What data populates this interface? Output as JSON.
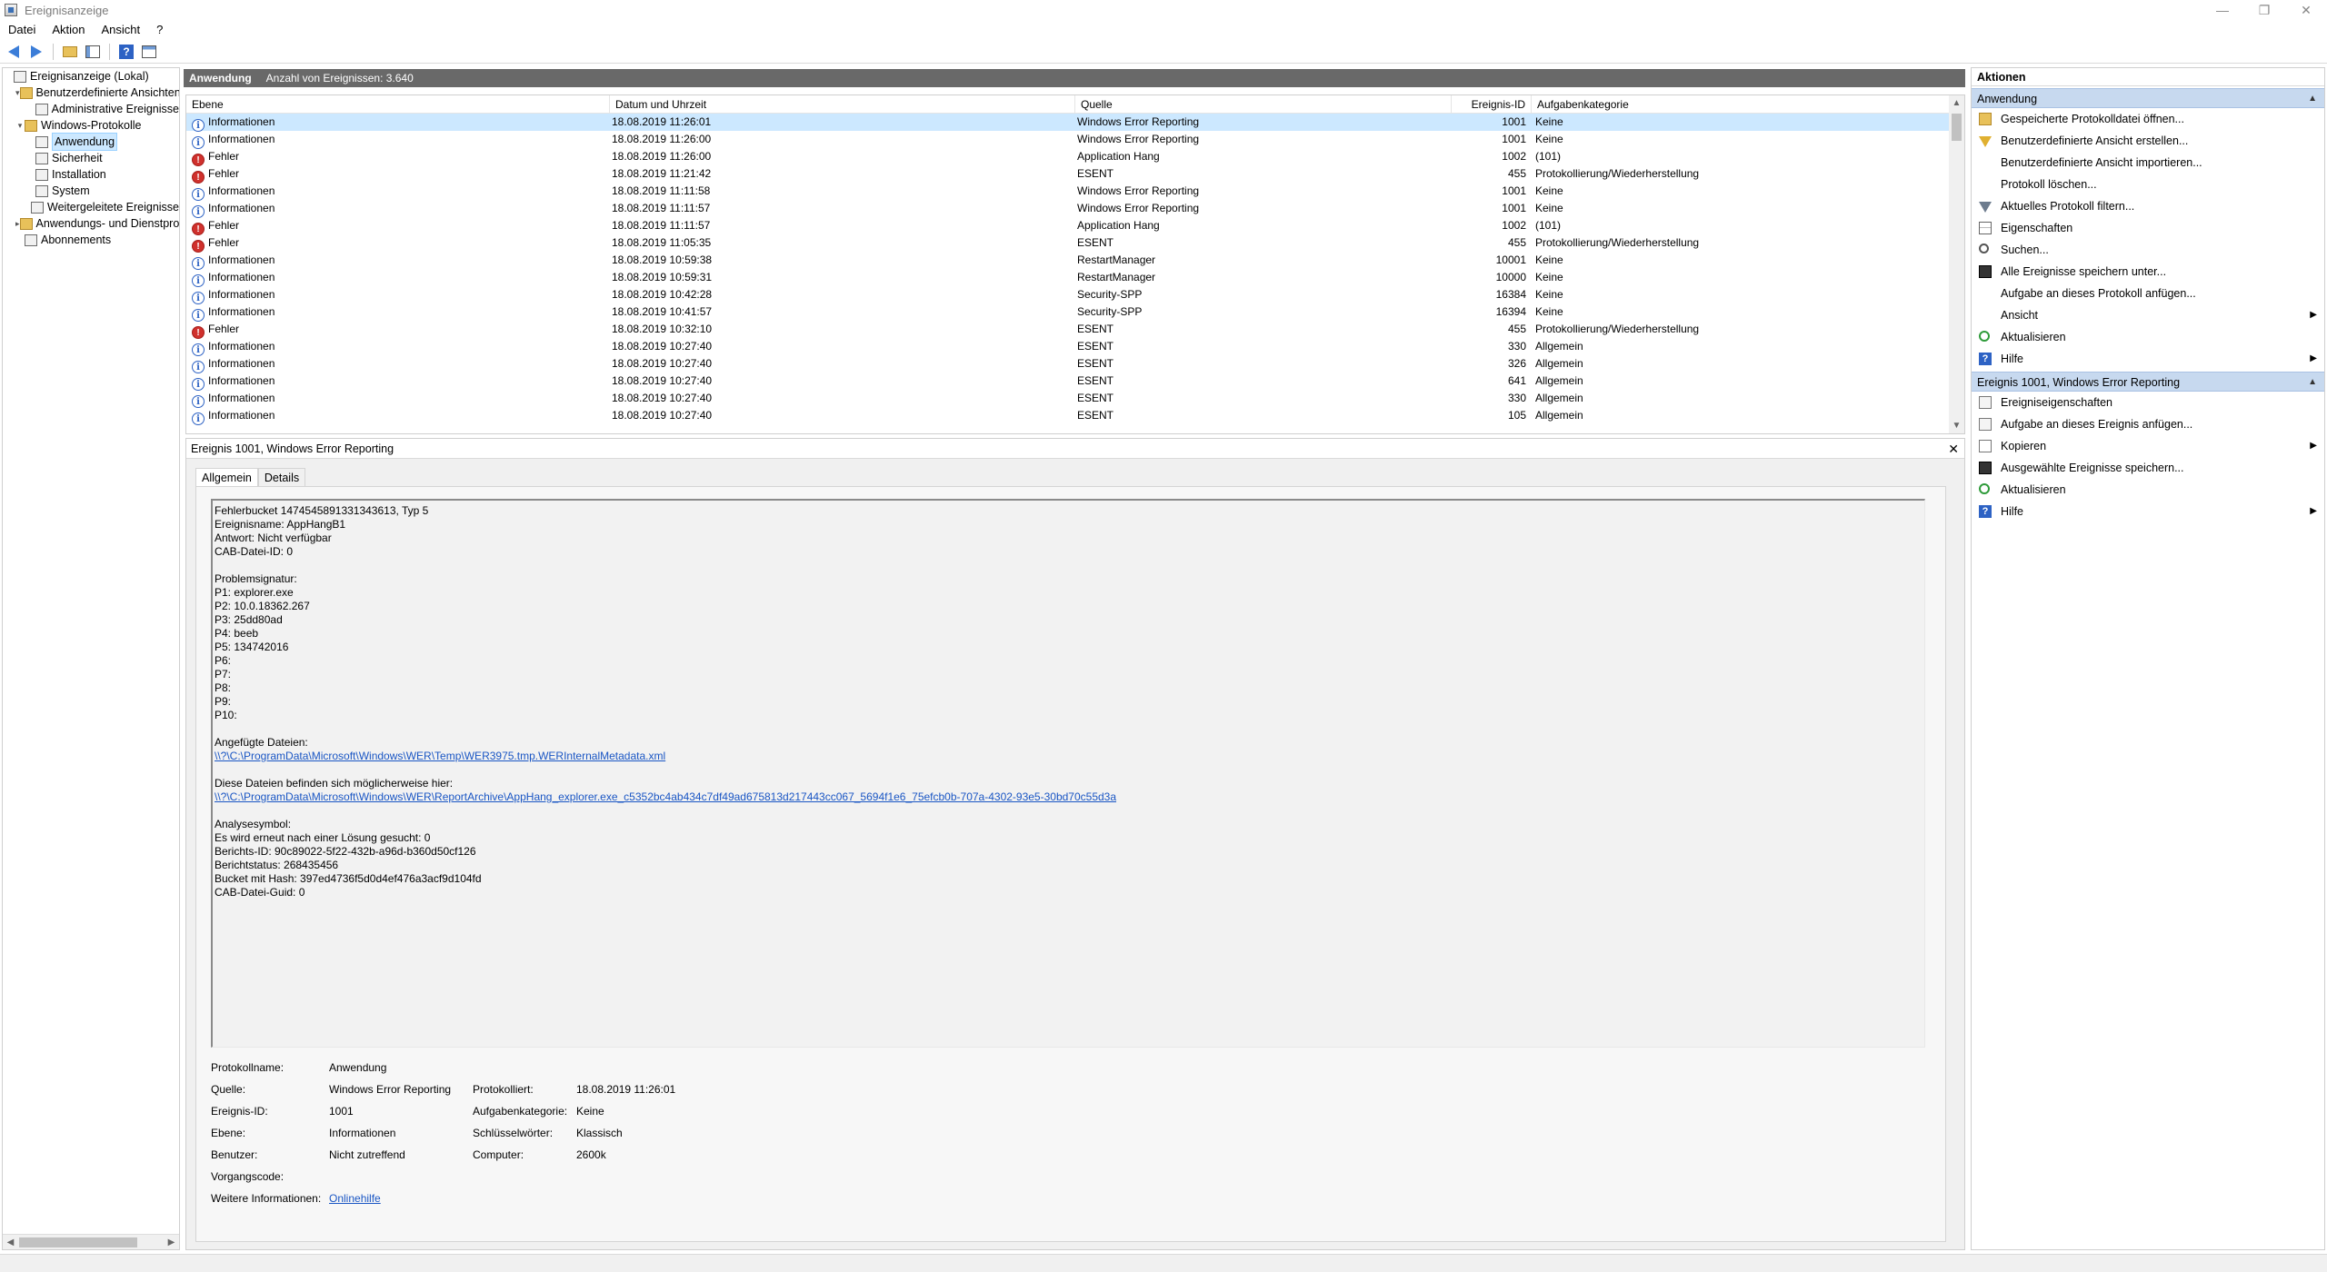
{
  "window": {
    "title": "Ereignisanzeige",
    "minimize": "—",
    "maximize": "❐",
    "close": "✕"
  },
  "menu": [
    "Datei",
    "Aktion",
    "Ansicht",
    "?"
  ],
  "toolbar_icons": [
    "back-icon",
    "forward-icon",
    "folder-up-icon",
    "show-hide-console-tree-icon",
    "help-icon",
    "show-hide-action-pane-icon"
  ],
  "tree": {
    "items": [
      {
        "label": "Ereignisanzeige (Lokal)",
        "level": 0,
        "exp": "",
        "icon": "computer"
      },
      {
        "label": "Benutzerdefinierte Ansichten",
        "level": 1,
        "exp": "▾",
        "icon": "folder"
      },
      {
        "label": "Administrative Ereignisse",
        "level": 2,
        "exp": "",
        "icon": "log"
      },
      {
        "label": "Windows-Protokolle",
        "level": 1,
        "exp": "▾",
        "icon": "folder"
      },
      {
        "label": "Anwendung",
        "level": 2,
        "exp": "",
        "icon": "log",
        "selected": true
      },
      {
        "label": "Sicherheit",
        "level": 2,
        "exp": "",
        "icon": "log"
      },
      {
        "label": "Installation",
        "level": 2,
        "exp": "",
        "icon": "log"
      },
      {
        "label": "System",
        "level": 2,
        "exp": "",
        "icon": "log"
      },
      {
        "label": "Weitergeleitete Ereignisse",
        "level": 2,
        "exp": "",
        "icon": "log"
      },
      {
        "label": "Anwendungs- und Dienstprotokolle",
        "level": 1,
        "exp": "▸",
        "icon": "folder"
      },
      {
        "label": "Abonnements",
        "level": 1,
        "exp": "",
        "icon": "log"
      }
    ]
  },
  "center": {
    "title": "Anwendung",
    "count": "Anzahl von Ereignissen: 3.640"
  },
  "list": {
    "columns": [
      "Ebene",
      "Datum und Uhrzeit",
      "Quelle",
      "Ereignis-ID",
      "Aufgabenkategorie"
    ],
    "rows": [
      {
        "type": "info",
        "level": "Informationen",
        "date": "18.08.2019 11:26:01",
        "source": "Windows Error Reporting",
        "id": "1001",
        "cat": "Keine",
        "selected": true
      },
      {
        "type": "info",
        "level": "Informationen",
        "date": "18.08.2019 11:26:00",
        "source": "Windows Error Reporting",
        "id": "1001",
        "cat": "Keine"
      },
      {
        "type": "err",
        "level": "Fehler",
        "date": "18.08.2019 11:26:00",
        "source": "Application Hang",
        "id": "1002",
        "cat": "(101)"
      },
      {
        "type": "err",
        "level": "Fehler",
        "date": "18.08.2019 11:21:42",
        "source": "ESENT",
        "id": "455",
        "cat": "Protokollierung/Wiederherstellung"
      },
      {
        "type": "info",
        "level": "Informationen",
        "date": "18.08.2019 11:11:58",
        "source": "Windows Error Reporting",
        "id": "1001",
        "cat": "Keine"
      },
      {
        "type": "info",
        "level": "Informationen",
        "date": "18.08.2019 11:11:57",
        "source": "Windows Error Reporting",
        "id": "1001",
        "cat": "Keine"
      },
      {
        "type": "err",
        "level": "Fehler",
        "date": "18.08.2019 11:11:57",
        "source": "Application Hang",
        "id": "1002",
        "cat": "(101)"
      },
      {
        "type": "err",
        "level": "Fehler",
        "date": "18.08.2019 11:05:35",
        "source": "ESENT",
        "id": "455",
        "cat": "Protokollierung/Wiederherstellung"
      },
      {
        "type": "info",
        "level": "Informationen",
        "date": "18.08.2019 10:59:38",
        "source": "RestartManager",
        "id": "10001",
        "cat": "Keine"
      },
      {
        "type": "info",
        "level": "Informationen",
        "date": "18.08.2019 10:59:31",
        "source": "RestartManager",
        "id": "10000",
        "cat": "Keine"
      },
      {
        "type": "info",
        "level": "Informationen",
        "date": "18.08.2019 10:42:28",
        "source": "Security-SPP",
        "id": "16384",
        "cat": "Keine"
      },
      {
        "type": "info",
        "level": "Informationen",
        "date": "18.08.2019 10:41:57",
        "source": "Security-SPP",
        "id": "16394",
        "cat": "Keine"
      },
      {
        "type": "err",
        "level": "Fehler",
        "date": "18.08.2019 10:32:10",
        "source": "ESENT",
        "id": "455",
        "cat": "Protokollierung/Wiederherstellung"
      },
      {
        "type": "info",
        "level": "Informationen",
        "date": "18.08.2019 10:27:40",
        "source": "ESENT",
        "id": "330",
        "cat": "Allgemein"
      },
      {
        "type": "info",
        "level": "Informationen",
        "date": "18.08.2019 10:27:40",
        "source": "ESENT",
        "id": "326",
        "cat": "Allgemein"
      },
      {
        "type": "info",
        "level": "Informationen",
        "date": "18.08.2019 10:27:40",
        "source": "ESENT",
        "id": "641",
        "cat": "Allgemein"
      },
      {
        "type": "info",
        "level": "Informationen",
        "date": "18.08.2019 10:27:40",
        "source": "ESENT",
        "id": "330",
        "cat": "Allgemein"
      },
      {
        "type": "info",
        "level": "Informationen",
        "date": "18.08.2019 10:27:40",
        "source": "ESENT",
        "id": "105",
        "cat": "Allgemein"
      }
    ]
  },
  "detail": {
    "title": "Ereignis 1001, Windows Error Reporting",
    "close": "✕",
    "tabs": [
      "Allgemein",
      "Details"
    ],
    "description": [
      {
        "t": "Fehlerbucket 1474545891331343613, Typ 5"
      },
      {
        "t": "Ereignisname: AppHangB1"
      },
      {
        "t": "Antwort: Nicht verfügbar"
      },
      {
        "t": "CAB-Datei-ID: 0"
      },
      {
        "t": ""
      },
      {
        "t": "Problemsignatur:"
      },
      {
        "t": "P1: explorer.exe"
      },
      {
        "t": "P2: 10.0.18362.267"
      },
      {
        "t": "P3: 25dd80ad"
      },
      {
        "t": "P4: beeb"
      },
      {
        "t": "P5: 134742016"
      },
      {
        "t": "P6:"
      },
      {
        "t": "P7:"
      },
      {
        "t": "P8:"
      },
      {
        "t": "P9:"
      },
      {
        "t": "P10:"
      },
      {
        "t": ""
      },
      {
        "t": "Angefügte Dateien:"
      },
      {
        "t": "\\\\?\\C:\\ProgramData\\Microsoft\\Windows\\WER\\Temp\\WER3975.tmp.WERInternalMetadata.xml",
        "link": true
      },
      {
        "t": ""
      },
      {
        "t": "Diese Dateien befinden sich möglicherweise hier:"
      },
      {
        "t": "\\\\?\\C:\\ProgramData\\Microsoft\\Windows\\WER\\ReportArchive\\AppHang_explorer.exe_c5352bc4ab434c7df49ad675813d217443cc067_5694f1e6_75efcb0b-707a-4302-93e5-30bd70c55d3a",
        "link": true
      },
      {
        "t": ""
      },
      {
        "t": "Analysesymbol:"
      },
      {
        "t": "Es wird erneut nach einer Lösung gesucht: 0"
      },
      {
        "t": "Berichts-ID: 90c89022-5f22-432b-a96d-b360d50cf126"
      },
      {
        "t": "Berichtstatus: 268435456"
      },
      {
        "t": "Bucket mit Hash: 397ed4736f5d0d4ef476a3acf9d104fd"
      },
      {
        "t": "CAB-Datei-Guid: 0"
      }
    ],
    "props": {
      "log_name_label": "Protokollname:",
      "log_name": "Anwendung",
      "source_label": "Quelle:",
      "source": "Windows Error Reporting",
      "logged_label": "Protokolliert:",
      "logged": "18.08.2019 11:26:01",
      "event_id_label": "Ereignis-ID:",
      "event_id": "1001",
      "task_label": "Aufgabenkategorie:",
      "task": "Keine",
      "level_label": "Ebene:",
      "level": "Informationen",
      "keywords_label": "Schlüsselwörter:",
      "keywords": "Klassisch",
      "user_label": "Benutzer:",
      "user": "Nicht zutreffend",
      "computer_label": "Computer:",
      "computer": "2600k",
      "opcode_label": "Vorgangscode:",
      "opcode": "",
      "more_label": "Weitere Informationen:",
      "more_link": "Onlinehilfe"
    }
  },
  "actions": {
    "header": "Aktionen",
    "sections": [
      {
        "title": "Anwendung",
        "items": [
          {
            "label": "Gespeicherte Protokolldatei öffnen...",
            "icon": "open"
          },
          {
            "label": "Benutzerdefinierte Ansicht erstellen...",
            "icon": "filter"
          },
          {
            "label": "Benutzerdefinierte Ansicht importieren...",
            "icon": "none"
          },
          {
            "label": "Protokoll löschen...",
            "icon": "none"
          },
          {
            "label": "Aktuelles Protokoll filtern...",
            "icon": "filter-grey"
          },
          {
            "label": "Eigenschaften",
            "icon": "props"
          },
          {
            "label": "Suchen...",
            "icon": "find"
          },
          {
            "label": "Alle Ereignisse speichern unter...",
            "icon": "save"
          },
          {
            "label": "Aufgabe an dieses Protokoll anfügen...",
            "icon": "none"
          },
          {
            "label": "Ansicht",
            "icon": "none",
            "sub": true
          },
          {
            "label": "Aktualisieren",
            "icon": "refresh"
          },
          {
            "label": "Hilfe",
            "icon": "help",
            "sub": true
          }
        ]
      },
      {
        "title": "Ereignis 1001, Windows Error Reporting",
        "items": [
          {
            "label": "Ereigniseigenschaften",
            "icon": "doc"
          },
          {
            "label": "Aufgabe an dieses Ereignis anfügen...",
            "icon": "doc"
          },
          {
            "label": "Kopieren",
            "icon": "copy",
            "sub": true
          },
          {
            "label": "Ausgewählte Ereignisse speichern...",
            "icon": "save"
          },
          {
            "label": "Aktualisieren",
            "icon": "refresh"
          },
          {
            "label": "Hilfe",
            "icon": "help",
            "sub": true
          }
        ]
      }
    ]
  }
}
